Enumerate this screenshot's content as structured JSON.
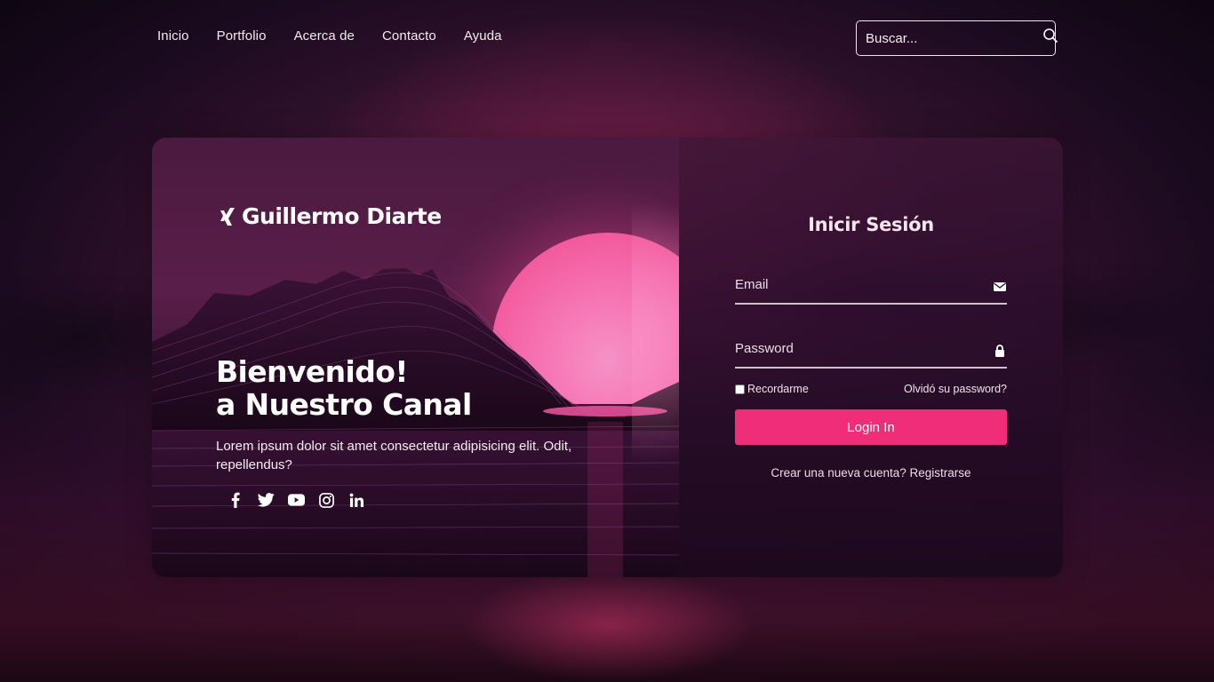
{
  "nav": {
    "items": [
      "Inicio",
      "Portfolio",
      "Acerca de",
      "Contacto",
      "Ayuda"
    ]
  },
  "search": {
    "placeholder": "Buscar...",
    "icon": "search-icon"
  },
  "brand": {
    "name": "Guillermo Diarte",
    "icon": "xing-icon"
  },
  "hero": {
    "line1": "Bienvenido!",
    "line2": "a Nuestro Canal",
    "description": "Lorem ipsum dolor sit amet consectetur adipisicing elit. Odit, repellendus?"
  },
  "social": [
    "facebook-icon",
    "twitter-icon",
    "youtube-icon",
    "instagram-icon",
    "linkedin-icon"
  ],
  "login": {
    "title": "Inicir Sesión",
    "email_label": "Email",
    "password_label": "Password",
    "remember_label": "Recordarme",
    "forgot_label": "Olvidó su password?",
    "button_label": "Login In",
    "register_label": "Crear una nueva cuenta? Registrarse"
  },
  "colors": {
    "accent": "#ef2d78",
    "sun": "#f676b4"
  }
}
